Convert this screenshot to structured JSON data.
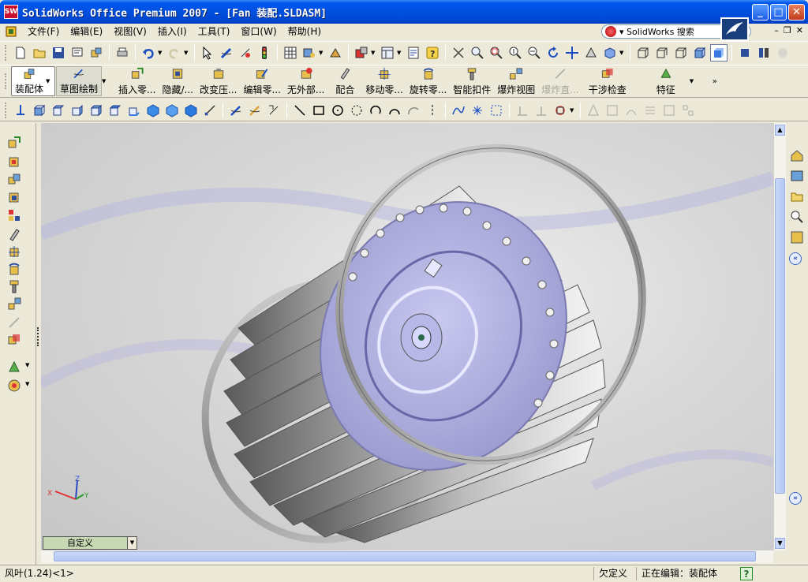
{
  "window": {
    "title": "SolidWorks Office Premium 2007 - [Fan 装配.SLDASM]",
    "app_icon_text": "SW",
    "minimize": "_",
    "maximize": "□",
    "close": "✕"
  },
  "menu": {
    "items": [
      "文件(F)",
      "编辑(E)",
      "视图(V)",
      "插入(I)",
      "工具(T)",
      "窗口(W)",
      "帮助(H)"
    ],
    "search_text": "▾ SolidWorks 搜索"
  },
  "command_manager": {
    "buttons": [
      {
        "label": "装配体",
        "icon": "assembly-icon"
      },
      {
        "label": "草图绘制",
        "icon": "sketch-icon"
      },
      {
        "label": "插入零...",
        "icon": "insert-component-icon"
      },
      {
        "label": "隐藏/...",
        "icon": "hide-show-icon"
      },
      {
        "label": "改变压...",
        "icon": "change-suppression-icon"
      },
      {
        "label": "编辑零...",
        "icon": "edit-component-icon"
      },
      {
        "label": "无外部...",
        "icon": "no-external-refs-icon"
      },
      {
        "label": "配合",
        "icon": "mate-icon"
      },
      {
        "label": "移动零...",
        "icon": "move-component-icon"
      },
      {
        "label": "旋转零...",
        "icon": "rotate-component-icon"
      },
      {
        "label": "智能扣件",
        "icon": "smart-fasteners-icon"
      },
      {
        "label": "爆炸视图",
        "icon": "exploded-view-icon"
      },
      {
        "label": "爆炸直...",
        "icon": "explode-line-sketch-icon"
      },
      {
        "label": "干涉检查",
        "icon": "interference-detection-icon"
      },
      {
        "label": "特征",
        "icon": "features-icon"
      }
    ]
  },
  "viewport": {
    "model": "centrifugal-fan-impeller",
    "triad_labels": {
      "x": "X",
      "y": "Y",
      "z": "Z"
    }
  },
  "configuration": {
    "value": "自定义"
  },
  "status": {
    "component": "风叶(1.24)<1>",
    "units": "欠定义",
    "mode": "正在编辑：装配体",
    "help": "?"
  },
  "colors": {
    "titlebar": "#0054e3",
    "chrome": "#ece9d8",
    "model_face": "#a7a7d8",
    "model_metal": "#8e8e8e"
  }
}
